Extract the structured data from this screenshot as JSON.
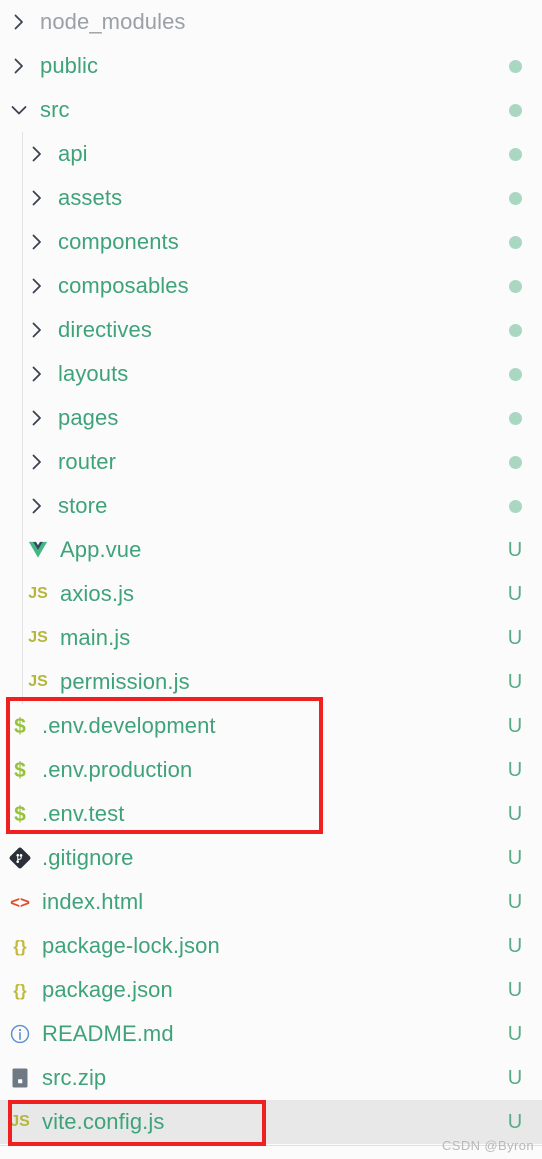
{
  "explorer": {
    "background": "#fbfbfb",
    "selected_row_background": "#e8e8e8",
    "name_color": "#3fa37a",
    "ignored_name_color": "#9aa0a6",
    "badge_color": "#5aab88",
    "dot_color": "#a9d7c2",
    "annotation_color": "#f02020",
    "rows": [
      {
        "label": "node_modules",
        "kind": "folder",
        "twisty": "chevron-right-icon",
        "indent": 0,
        "status": "",
        "ignored": true
      },
      {
        "label": "public",
        "kind": "folder",
        "twisty": "chevron-right-icon",
        "indent": 0,
        "status": "dot",
        "ignored": false
      },
      {
        "label": "src",
        "kind": "folder",
        "twisty": "chevron-down-icon",
        "indent": 0,
        "status": "dot",
        "ignored": false
      },
      {
        "label": "api",
        "kind": "folder",
        "twisty": "chevron-right-icon",
        "indent": 1,
        "status": "dot",
        "ignored": false
      },
      {
        "label": "assets",
        "kind": "folder",
        "twisty": "chevron-right-icon",
        "indent": 1,
        "status": "dot",
        "ignored": false
      },
      {
        "label": "components",
        "kind": "folder",
        "twisty": "chevron-right-icon",
        "indent": 1,
        "status": "dot",
        "ignored": false
      },
      {
        "label": "composables",
        "kind": "folder",
        "twisty": "chevron-right-icon",
        "indent": 1,
        "status": "dot",
        "ignored": false
      },
      {
        "label": "directives",
        "kind": "folder",
        "twisty": "chevron-right-icon",
        "indent": 1,
        "status": "dot",
        "ignored": false
      },
      {
        "label": "layouts",
        "kind": "folder",
        "twisty": "chevron-right-icon",
        "indent": 1,
        "status": "dot",
        "ignored": false
      },
      {
        "label": "pages",
        "kind": "folder",
        "twisty": "chevron-right-icon",
        "indent": 1,
        "status": "dot",
        "ignored": false
      },
      {
        "label": "router",
        "kind": "folder",
        "twisty": "chevron-right-icon",
        "indent": 1,
        "status": "dot",
        "ignored": false
      },
      {
        "label": "store",
        "kind": "folder",
        "twisty": "chevron-right-icon",
        "indent": 1,
        "status": "dot",
        "ignored": false
      },
      {
        "label": "App.vue",
        "kind": "file",
        "icon": "vue-icon",
        "indent": 1,
        "status": "U",
        "ignored": false
      },
      {
        "label": "axios.js",
        "kind": "file",
        "icon": "js-icon",
        "icon_text": "JS",
        "indent": 1,
        "status": "U",
        "ignored": false
      },
      {
        "label": "main.js",
        "kind": "file",
        "icon": "js-icon",
        "icon_text": "JS",
        "indent": 1,
        "status": "U",
        "ignored": false
      },
      {
        "label": "permission.js",
        "kind": "file",
        "icon": "js-icon",
        "icon_text": "JS",
        "indent": 1,
        "status": "U",
        "ignored": false
      },
      {
        "label": ".env.development",
        "kind": "file",
        "icon": "env-icon",
        "icon_text": "$",
        "indent": 0,
        "status": "U",
        "ignored": false
      },
      {
        "label": ".env.production",
        "kind": "file",
        "icon": "env-icon",
        "icon_text": "$",
        "indent": 0,
        "status": "U",
        "ignored": false
      },
      {
        "label": ".env.test",
        "kind": "file",
        "icon": "env-icon",
        "icon_text": "$",
        "indent": 0,
        "status": "U",
        "ignored": false
      },
      {
        "label": ".gitignore",
        "kind": "file",
        "icon": "git-icon",
        "indent": 0,
        "status": "U",
        "ignored": false
      },
      {
        "label": "index.html",
        "kind": "file",
        "icon": "html-icon",
        "icon_text": "<>",
        "indent": 0,
        "status": "U",
        "ignored": false
      },
      {
        "label": "package-lock.json",
        "kind": "file",
        "icon": "json-icon",
        "icon_text": "{}",
        "indent": 0,
        "status": "U",
        "ignored": false
      },
      {
        "label": "package.json",
        "kind": "file",
        "icon": "json-icon",
        "icon_text": "{}",
        "indent": 0,
        "status": "U",
        "ignored": false
      },
      {
        "label": "README.md",
        "kind": "file",
        "icon": "info-circle-icon",
        "indent": 0,
        "status": "U",
        "ignored": false
      },
      {
        "label": "src.zip",
        "kind": "file",
        "icon": "archive-icon",
        "indent": 0,
        "status": "U",
        "ignored": false
      },
      {
        "label": "vite.config.js",
        "kind": "file",
        "icon": "js-icon",
        "icon_text": "JS",
        "indent": 0,
        "status": "U",
        "ignored": false,
        "selected": true
      }
    ]
  },
  "annotations": {
    "env_group_box_label": "env-files-highlight",
    "vite_box_label": "vite-config-highlight"
  },
  "watermark": {
    "text": "CSDN @Byron"
  }
}
